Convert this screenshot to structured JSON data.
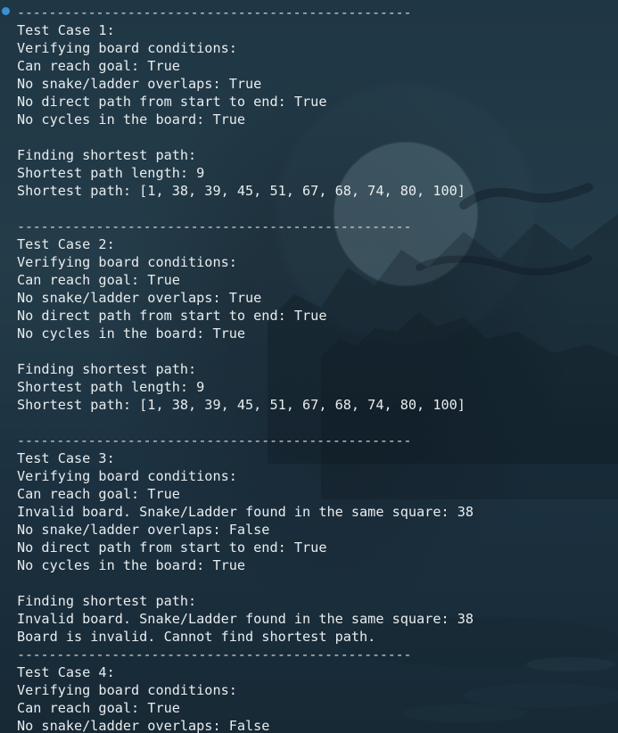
{
  "terminal": {
    "lines": [
      "--------------------------------------------------",
      "Test Case 1:",
      "Verifying board conditions:",
      "Can reach goal: True",
      "No snake/ladder overlaps: True",
      "No direct path from start to end: True",
      "No cycles in the board: True",
      "",
      "Finding shortest path:",
      "Shortest path length: 9",
      "Shortest path: [1, 38, 39, 45, 51, 67, 68, 74, 80, 100]",
      "",
      "--------------------------------------------------",
      "Test Case 2:",
      "Verifying board conditions:",
      "Can reach goal: True",
      "No snake/ladder overlaps: True",
      "No direct path from start to end: True",
      "No cycles in the board: True",
      "",
      "Finding shortest path:",
      "Shortest path length: 9",
      "Shortest path: [1, 38, 39, 45, 51, 67, 68, 74, 80, 100]",
      "",
      "--------------------------------------------------",
      "Test Case 3:",
      "Verifying board conditions:",
      "Can reach goal: True",
      "Invalid board. Snake/Ladder found in the same square: 38",
      "No snake/ladder overlaps: False",
      "No direct path from start to end: True",
      "No cycles in the board: True",
      "",
      "Finding shortest path:",
      "Invalid board. Snake/Ladder found in the same square: 38",
      "Board is invalid. Cannot find shortest path.",
      "--------------------------------------------------",
      "Test Case 4:",
      "Verifying board conditions:",
      "Can reach goal: True",
      "No snake/ladder overlaps: False"
    ]
  },
  "colors": {
    "background": "#1f3644",
    "text": "#e8ecee",
    "status_dot": "#3a8fd6"
  }
}
